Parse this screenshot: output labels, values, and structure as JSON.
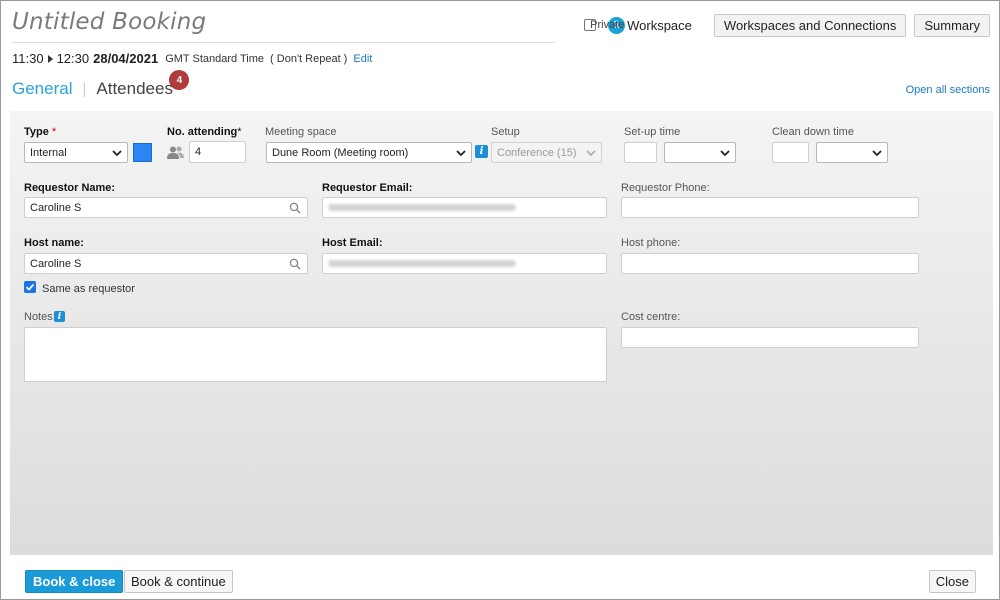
{
  "header": {
    "title": "Untitled Booking",
    "private_label": "Private",
    "workspace_count": "1",
    "workspace_label": "Workspace",
    "workspaces_connections_button": "Workspaces and Connections",
    "summary_button": "Summary"
  },
  "time": {
    "start": "11:30",
    "end": "12:30",
    "date": "28/04/2021",
    "timezone": "GMT Standard Time",
    "repeat": "( Don't Repeat )",
    "edit_link": "Edit"
  },
  "tabs": {
    "general": "General",
    "separator": "|",
    "attendees": "Attendees",
    "attendees_count": "4",
    "open_all": "Open all sections"
  },
  "form": {
    "type_label": "Type",
    "type_required": "*",
    "type_value": "Internal",
    "type_color": "#2a86f4",
    "attending_label": "No. attending",
    "attending_required": "*",
    "attending_value": "4",
    "space_label": "Meeting space",
    "space_value": "Dune Room (Meeting room)",
    "setup_label": "Setup",
    "setup_value": "Conference (15)",
    "setup_time_label": "Set-up time",
    "clean_label": "Clean down time",
    "requestor_name_label": "Requestor Name:",
    "requestor_name_value": "Caroline S",
    "requestor_email_label": "Requestor Email:",
    "requestor_phone_label": "Requestor Phone:",
    "host_name_label": "Host name:",
    "host_name_value": "Caroline S",
    "host_email_label": "Host Email:",
    "host_phone_label": "Host phone:",
    "same_as_requestor": "Same as requestor",
    "same_as_requestor_checked": true,
    "notes_label": "Notes:",
    "cost_centre_label": "Cost centre:"
  },
  "footer": {
    "book_close": "Book & close",
    "book_continue": "Book & continue",
    "close": "Close"
  },
  "colors": {
    "accent": "#1a9ad6",
    "tab_active": "#2ba3d8",
    "badge": "#b03b3b",
    "link": "#1a7bbf"
  }
}
